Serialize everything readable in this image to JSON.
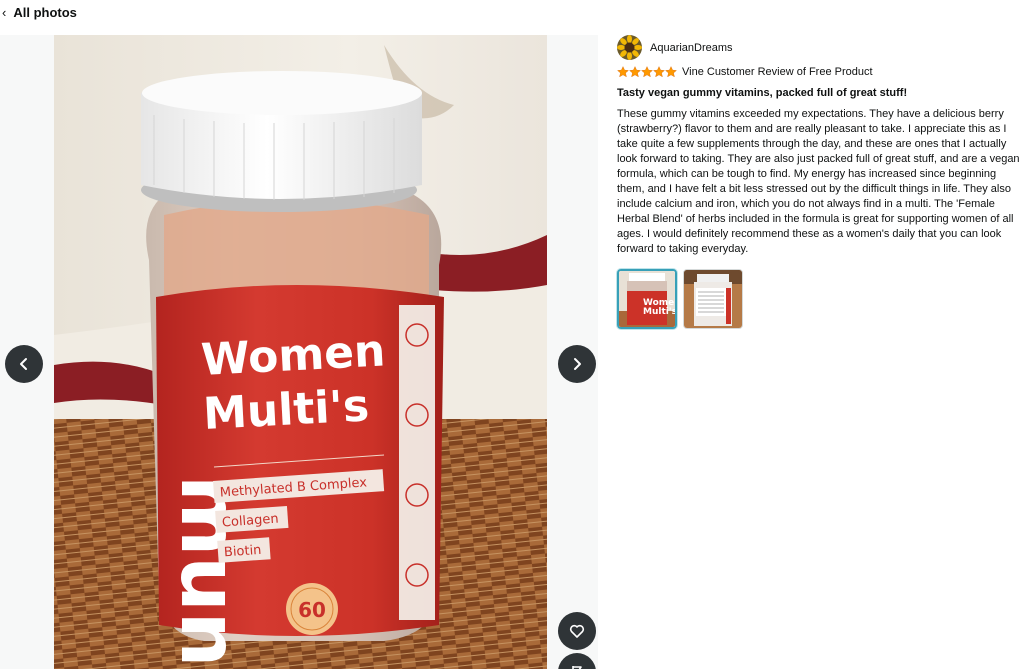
{
  "header": {
    "back_label": "All photos"
  },
  "review": {
    "reviewer_name": "AquarianDreams",
    "rating": 5,
    "rating_max": 5,
    "badge": "Vine Customer Review of Free Product",
    "title": "Tasty vegan gummy vitamins, packed full of great stuff!",
    "body": "These gummy vitamins exceeded my expectations. They have a delicious berry (strawberry?) flavor to them and are really pleasant to take. I appreciate this as I take quite a few supplements through the day, and these are ones that I actually look forward to taking. They are also just packed full of great stuff, and are a vegan formula, which can be tough to find. My energy has increased since beginning them, and I have felt a bit less stressed out by the difficult things in life. They also include calcium and iron, which you do not always find in a multi. The 'Female Herbal Blend' of herbs included in the formula is great for supporting women of all ages. I would definitely recommend these as a women's daily that you can look forward to taking everyday."
  },
  "photo": {
    "brand": "mun",
    "product_line1": "Women",
    "product_line2": "Multi's",
    "features": [
      "Methylated B Complex",
      "Collagen",
      "Biotin"
    ],
    "count": "60"
  },
  "thumbnails": {
    "selected_index": 0,
    "count": 2
  },
  "colors": {
    "accent": "#37a0b8",
    "star": "#ff9900",
    "button": "#2f3437",
    "label_red": "#c8302a"
  },
  "icons": {
    "back": "chevron-left-icon",
    "prev": "chevron-left-icon",
    "next": "chevron-right-icon",
    "heart": "heart-icon",
    "flag": "flag-icon"
  }
}
